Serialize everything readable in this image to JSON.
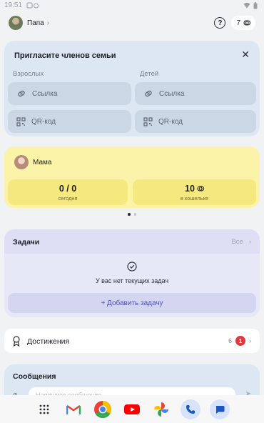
{
  "status_bar": {
    "time": "19:51"
  },
  "header": {
    "user_name": "Папа",
    "coins": "7"
  },
  "invite": {
    "title": "Пригласите членов семьи",
    "adults_label": "Взрослых",
    "children_label": "Детей",
    "link_label": "Ссылка",
    "qr_label": "QR-код"
  },
  "family": {
    "member_name": "Мама",
    "today_value": "0 / 0",
    "today_label": "сегодня",
    "wallet_value": "10",
    "wallet_label": "в кошельке"
  },
  "tasks": {
    "title": "Задачи",
    "all_label": "Все",
    "empty_text": "У вас нет текущих задач",
    "add_label": "+ Добавить задачу"
  },
  "achievements": {
    "label": "Достижения",
    "count": "6",
    "badge": "1"
  },
  "messages": {
    "title": "Сообщения",
    "placeholder": "Напишите сообщение"
  },
  "colors": {
    "invite_bg": "#dde7f3",
    "family_bg": "#fbf3a8",
    "tasks_bg": "#e7e8f7",
    "badge": "#e0393e",
    "accent": "#4c4fb8"
  },
  "dock_apps": [
    "app-drawer-icon",
    "gmail-icon",
    "chrome-icon",
    "youtube-icon",
    "photos-icon",
    "phone-icon",
    "messages-icon"
  ]
}
